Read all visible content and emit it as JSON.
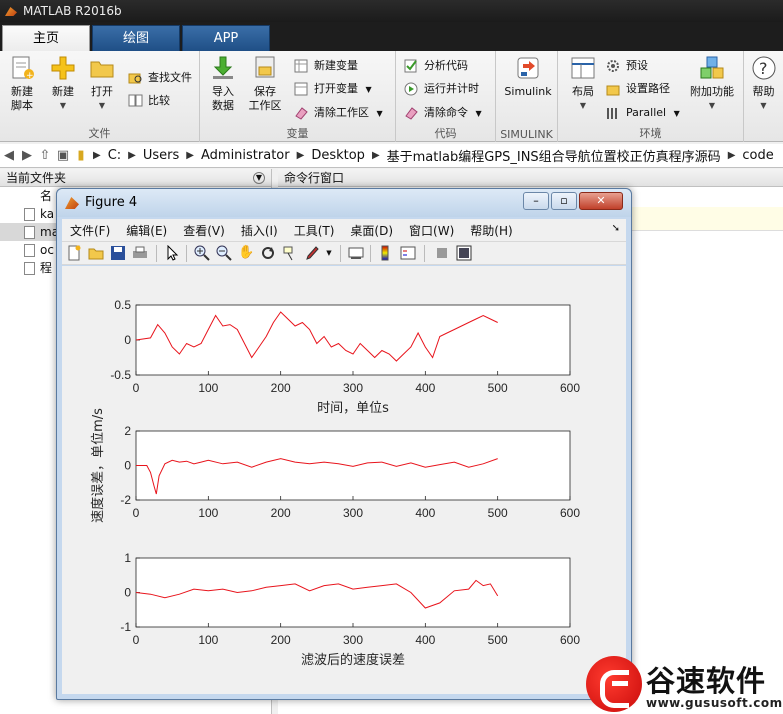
{
  "app": {
    "title": "MATLAB R2016b"
  },
  "tabs": [
    {
      "label": "主页"
    },
    {
      "label": "绘图"
    },
    {
      "label": "APP"
    }
  ],
  "ribbon": {
    "groups": {
      "file": "文件",
      "variable": "变量",
      "code": "代码",
      "simulink": "SIMULINK",
      "environment": "环境"
    },
    "new_script": "新建\n脚本",
    "new": "新建",
    "open": "打开",
    "find_files": "查找文件",
    "compare": "比较",
    "import_data": "导入\n数据",
    "save_workspace": "保存\n工作区",
    "new_variable": "新建变量",
    "open_variable": "打开变量",
    "clear_workspace": "清除工作区",
    "analyze_code": "分析代码",
    "run_and_time": "运行并计时",
    "clear_commands": "清除命令",
    "simulink": "Simulink",
    "layout": "布局",
    "preferences": "预设",
    "set_path": "设置路径",
    "parallel": "Parallel",
    "addons": "附加功能",
    "help": "帮助"
  },
  "address": {
    "crumbs": [
      "C:",
      "Users",
      "Administrator",
      "Desktop",
      "基于matlab编程GPS_INS组合导航位置校正仿真程序源码",
      "code"
    ]
  },
  "left_pane": {
    "title": "当前文件夹",
    "header_col": "名",
    "items": [
      "ka",
      "ma",
      "oc",
      "程"
    ]
  },
  "right_pane": {
    "title": "命令行窗口"
  },
  "figure": {
    "title": "Figure 4",
    "menu": [
      "文件(F)",
      "编辑(E)",
      "查看(V)",
      "插入(I)",
      "工具(T)",
      "桌面(D)",
      "窗口(W)",
      "帮助(H)"
    ],
    "toolbar_icons": [
      "new-figure-icon",
      "open-file-icon",
      "save-icon",
      "print-icon",
      "pointer-icon",
      "zoom-in-icon",
      "zoom-out-icon",
      "pan-icon",
      "rotate-icon",
      "data-cursor-icon",
      "brush-icon",
      "link-icon",
      "colorbar-icon",
      "legend-icon",
      "hide-plot-tools-icon",
      "show-plot-tools-icon"
    ]
  },
  "watermark": {
    "name": "谷速软件",
    "url": "www.gususoft.com"
  },
  "colors": {
    "series": "#e8141c",
    "accent": "#2a63a8"
  },
  "chart_data": [
    {
      "type": "line",
      "xlabel": "时间，单位s",
      "ylabel": "",
      "xlim": [
        0,
        600
      ],
      "ylim": [
        -0.5,
        0.5
      ],
      "xticks": [
        0,
        100,
        200,
        300,
        400,
        500,
        600
      ],
      "yticks": [
        "0.5",
        "0",
        "-0.5"
      ],
      "x": [
        0,
        20,
        30,
        40,
        50,
        60,
        70,
        80,
        90,
        100,
        110,
        120,
        130,
        140,
        150,
        160,
        170,
        180,
        190,
        200,
        210,
        220,
        230,
        240,
        250,
        260,
        270,
        280,
        290,
        300,
        310,
        320,
        330,
        340,
        350,
        360,
        370,
        380,
        390,
        400,
        410,
        420,
        430,
        440,
        450,
        460,
        470,
        480,
        490,
        500
      ],
      "y": [
        0,
        0.03,
        0.22,
        0.1,
        -0.1,
        -0.2,
        -0.05,
        -0.1,
        -0.05,
        0.15,
        0.35,
        0.2,
        0.22,
        0.15,
        -0.05,
        -0.25,
        -0.1,
        0.05,
        0.25,
        0.4,
        0.3,
        0.2,
        0.25,
        0.15,
        -0.05,
        0.05,
        -0.1,
        -0.05,
        -0.15,
        -0.2,
        -0.05,
        -0.15,
        -0.25,
        -0.15,
        -0.2,
        -0.3,
        -0.2,
        -0.1,
        0.1,
        -0.1,
        -0.25,
        0.05,
        0.1,
        0.15,
        0.2,
        0.25,
        0.3,
        0.35,
        0.3,
        0.25
      ]
    },
    {
      "type": "line",
      "xlabel": "",
      "ylabel": "速度误差，单位m/s",
      "xlim": [
        0,
        600
      ],
      "ylim": [
        -2,
        2
      ],
      "xticks": [
        0,
        100,
        200,
        300,
        400,
        500,
        600
      ],
      "yticks": [
        "2",
        "0",
        "-2"
      ],
      "x": [
        0,
        15,
        20,
        25,
        28,
        32,
        40,
        50,
        60,
        70,
        80,
        90,
        100,
        120,
        140,
        160,
        180,
        200,
        220,
        240,
        260,
        280,
        300,
        320,
        340,
        360,
        380,
        400,
        420,
        440,
        460,
        480,
        500
      ],
      "y": [
        0,
        0,
        -0.4,
        -1.2,
        -1.65,
        -0.6,
        0.1,
        0.3,
        0.2,
        0.25,
        0.1,
        0.2,
        0.3,
        0.1,
        0.2,
        -0.1,
        0.2,
        0.4,
        0.2,
        0.1,
        0.2,
        0.1,
        -0.05,
        0.15,
        0.2,
        -0.05,
        0.15,
        -0.1,
        0.05,
        0.2,
        -0.1,
        0.1,
        0.4
      ]
    },
    {
      "type": "line",
      "xlabel": "滤波后的速度误差",
      "ylabel": "",
      "xlim": [
        0,
        600
      ],
      "ylim": [
        -1,
        1
      ],
      "xticks": [
        0,
        100,
        200,
        300,
        400,
        500,
        600
      ],
      "yticks": [
        "1",
        "0",
        "-1"
      ],
      "x": [
        0,
        20,
        40,
        60,
        80,
        100,
        120,
        140,
        160,
        180,
        200,
        220,
        240,
        260,
        280,
        300,
        320,
        340,
        360,
        380,
        400,
        420,
        440,
        460,
        470,
        480,
        490,
        500
      ],
      "y": [
        0,
        -0.05,
        -0.15,
        -0.05,
        0.1,
        0.05,
        0.1,
        0.0,
        0.05,
        0.15,
        0.2,
        0.25,
        0.05,
        0.2,
        0.25,
        0.1,
        0.15,
        0.2,
        0.25,
        0.0,
        -0.45,
        -0.3,
        0.05,
        0.1,
        0.35,
        0.2,
        0.25,
        -0.1
      ]
    }
  ]
}
